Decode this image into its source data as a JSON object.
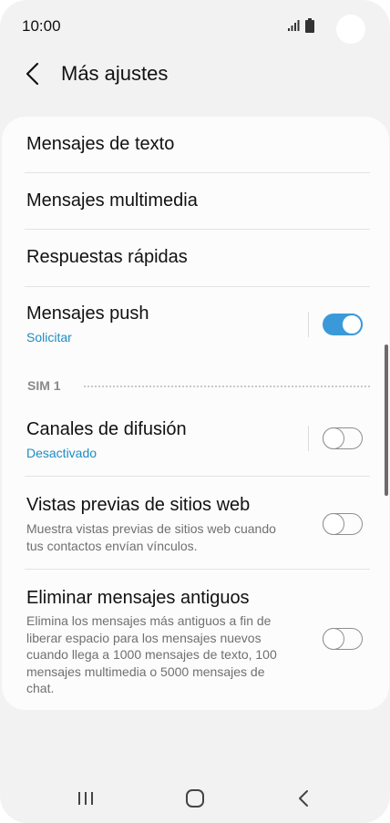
{
  "status_bar": {
    "time": "10:00"
  },
  "header": {
    "title": "Más ajustes"
  },
  "settings": {
    "text_messages": "Mensajes de texto",
    "multimedia_messages": "Mensajes multimedia",
    "quick_responses": "Respuestas rápidas",
    "push_messages": {
      "label": "Mensajes push",
      "sub": "Solicitar",
      "enabled": true
    },
    "section_sim": "SIM 1",
    "broadcast_channels": {
      "label": "Canales de difusión",
      "sub": "Desactivado",
      "enabled": false
    },
    "link_previews": {
      "label": "Vistas previas de sitios web",
      "desc": "Muestra vistas previas de sitios web cuando tus contactos envían vínculos.",
      "enabled": false
    },
    "delete_old": {
      "label": "Eliminar mensajes antiguos",
      "desc": "Elimina los mensajes más antiguos a fin de liberar espacio para los mensajes nuevos cuando llega a 1000 mensajes de texto, 100 mensajes multimedia o 5000 mensajes de chat.",
      "enabled": false
    }
  },
  "colors": {
    "accent": "#3a9ad9",
    "sub_text": "#1d8cc3",
    "background": "#f2f2f2",
    "card": "#fcfcfc"
  },
  "icons": {
    "back": "chevron-left-icon",
    "signal": "signal-icon",
    "battery": "battery-icon",
    "nav_recents": "recents-icon",
    "nav_home": "home-icon",
    "nav_back": "back-nav-icon"
  }
}
